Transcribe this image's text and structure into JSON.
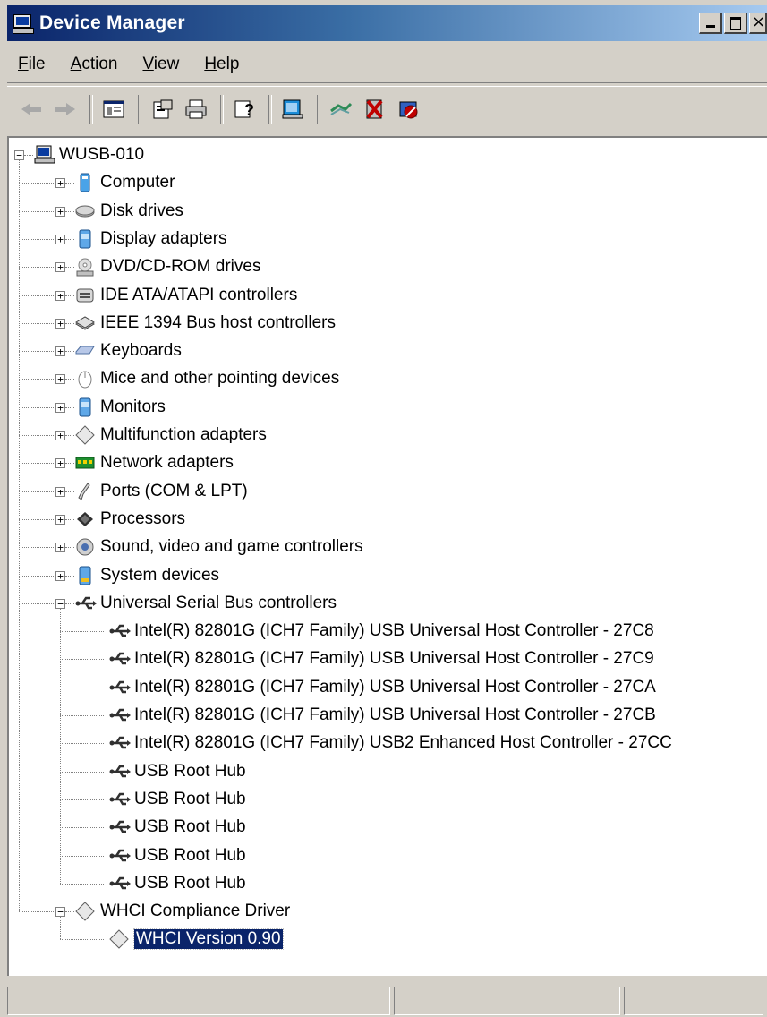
{
  "window": {
    "title": "Device Manager"
  },
  "menu": [
    {
      "label_u": "F",
      "label_rest": "ile"
    },
    {
      "label_u": "A",
      "label_rest": "ction"
    },
    {
      "label_u": "V",
      "label_rest": "iew"
    },
    {
      "label_u": "H",
      "label_rest": "elp"
    }
  ],
  "toolbar": [
    "back-arrow-icon",
    "forward-arrow-icon",
    "show-hide-console-tree-icon",
    "properties-icon",
    "print-icon",
    "help-icon",
    "scan-hardware-icon",
    "update-driver-icon",
    "uninstall-icon",
    "disable-icon"
  ],
  "tree": {
    "root": "WUSB-010",
    "categories": [
      {
        "label": "Computer",
        "icon": "computer-icon",
        "expanded": false
      },
      {
        "label": "Disk drives",
        "icon": "disk-drive-icon",
        "expanded": false
      },
      {
        "label": "Display adapters",
        "icon": "display-adapter-icon",
        "expanded": false
      },
      {
        "label": "DVD/CD-ROM drives",
        "icon": "dvd-drive-icon",
        "expanded": false
      },
      {
        "label": "IDE ATA/ATAPI controllers",
        "icon": "ide-controller-icon",
        "expanded": false
      },
      {
        "label": "IEEE 1394 Bus host controllers",
        "icon": "ieee1394-icon",
        "expanded": false
      },
      {
        "label": "Keyboards",
        "icon": "keyboard-icon",
        "expanded": false
      },
      {
        "label": "Mice and other pointing devices",
        "icon": "mouse-icon",
        "expanded": false
      },
      {
        "label": "Monitors",
        "icon": "monitor-icon",
        "expanded": false
      },
      {
        "label": "Multifunction adapters",
        "icon": "multifunction-icon",
        "expanded": false
      },
      {
        "label": "Network adapters",
        "icon": "network-adapter-icon",
        "expanded": false
      },
      {
        "label": "Ports (COM & LPT)",
        "icon": "port-icon",
        "expanded": false
      },
      {
        "label": "Processors",
        "icon": "processor-icon",
        "expanded": false
      },
      {
        "label": "Sound, video and game controllers",
        "icon": "sound-icon",
        "expanded": false
      },
      {
        "label": "System devices",
        "icon": "system-device-icon",
        "expanded": false
      },
      {
        "label": "Universal Serial Bus controllers",
        "icon": "usb-icon",
        "expanded": true,
        "children": [
          "Intel(R) 82801G (ICH7 Family) USB Universal Host Controller - 27C8",
          "Intel(R) 82801G (ICH7 Family) USB Universal Host Controller - 27C9",
          "Intel(R) 82801G (ICH7 Family) USB Universal Host Controller - 27CA",
          "Intel(R) 82801G (ICH7 Family) USB Universal Host Controller - 27CB",
          "Intel(R) 82801G (ICH7 Family) USB2 Enhanced Host Controller - 27CC",
          "USB Root Hub",
          "USB Root Hub",
          "USB Root Hub",
          "USB Root Hub",
          "USB Root Hub"
        ]
      },
      {
        "label": "WHCI Compliance Driver",
        "icon": "diamond-icon",
        "expanded": true,
        "children": [
          "WHCI Version 0.90"
        ],
        "selected_child": 0
      }
    ]
  },
  "colors": {
    "title_start": "#0a246a",
    "title_end": "#a6caf0",
    "selection": "#0a246a",
    "chrome": "#d4d0c8"
  }
}
